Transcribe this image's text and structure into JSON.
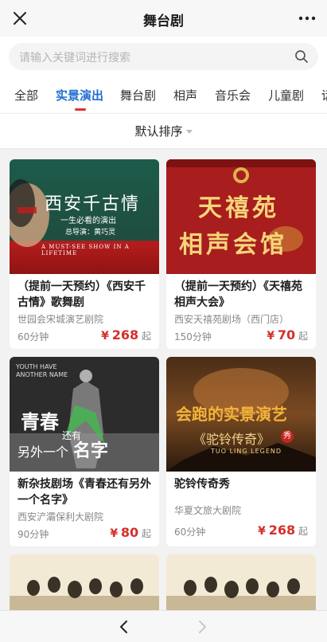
{
  "header": {
    "title": "舞台剧"
  },
  "search": {
    "placeholder": "请输入关键词进行搜索"
  },
  "tabs": [
    {
      "label": "全部"
    },
    {
      "label": "实景演出"
    },
    {
      "label": "舞台剧"
    },
    {
      "label": "相声"
    },
    {
      "label": "音乐会"
    },
    {
      "label": "儿童剧"
    },
    {
      "label": "话"
    }
  ],
  "sort": {
    "label": "默认排序"
  },
  "cards": [
    {
      "name": "（提前一天预约）《西安千古情》歌舞剧",
      "venue": "世园会宋城演艺剧院",
      "duration": "60分钟",
      "currency": "¥",
      "price": "268",
      "suffix": "起",
      "poster": {
        "title": "西安千古情",
        "subtitle": "一生必看的演出",
        "director": "总导演：黄巧灵",
        "tagline": "A MUST-SEE SHOW IN A LIFETIME",
        "colors": {
          "top": "#1d5b4a",
          "bottom": "#b51d1d"
        }
      }
    },
    {
      "name": "（提前一天预约）《天禧苑相声大会》",
      "venue": "西安天禧苑剧场（西门店）",
      "duration": "150分钟",
      "currency": "¥",
      "price": "70",
      "suffix": "起",
      "poster": {
        "title_line1": "天禧苑",
        "title_line2": "相声会馆",
        "colors": {
          "bg": "#a81d1d",
          "text": "#f5d57a"
        }
      }
    },
    {
      "name": "新杂技剧场《青春还有另外一个名字》",
      "venue": "西安浐灞保利大剧院",
      "duration": "90分钟",
      "currency": "¥",
      "price": "80",
      "suffix": "起",
      "poster": {
        "top_text_1": "YOUTH HAVE",
        "top_text_2": "ANOTHER NAME",
        "callig_1": "青春",
        "callig_2": "还有",
        "callig_3": "另外一个",
        "callig_4": "名字",
        "colors": {
          "bg": "#2a2a2a",
          "accent": "#3fbf4c"
        }
      }
    },
    {
      "name": "驼铃传奇秀",
      "venue": "华夏文旅大剧院",
      "duration": "60分钟",
      "currency": "¥",
      "price": "268",
      "suffix": "起",
      "poster": {
        "headline": "会跑的实景演艺",
        "title": "《驼铃传奇》",
        "badge": "秀",
        "latin": "TUO LING LEGEND",
        "colors": {
          "bg": "#3b2414",
          "text": "#f2b43a"
        }
      }
    }
  ]
}
